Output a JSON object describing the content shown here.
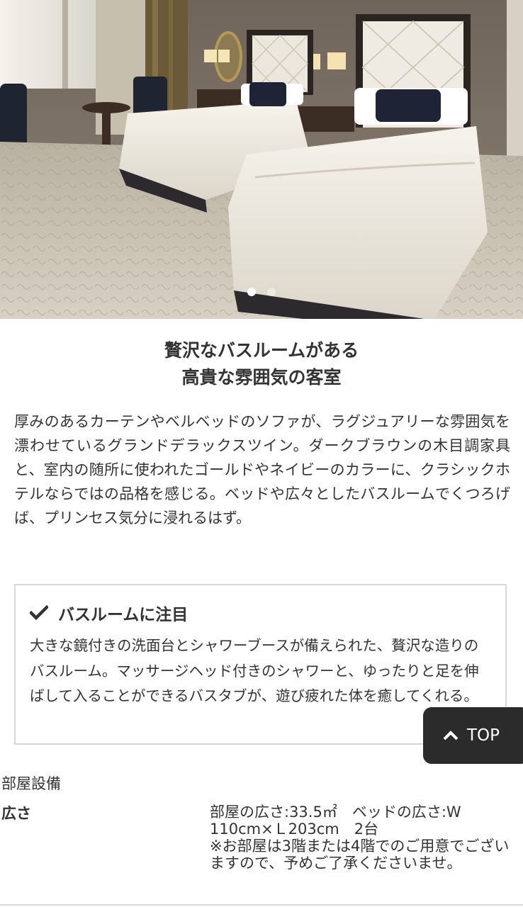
{
  "hero": {
    "image_alt": "",
    "carousel": {
      "total": 2,
      "active": 1
    }
  },
  "heading": {
    "line1": "贅沢なバスルームがある",
    "line2": "高貴な雰囲気の客室"
  },
  "description": "厚みのあるカーテンやベルベッドのソファが、ラグジュアリーな雰囲気を漂わせているグランドデラックスツイン。ダークブラウンの木目調家具と、室内の随所に使われたゴールドやネイビーのカラーに、クラシックホテルならではの品格を感じる。ベッドや広々としたバスルームでくつろげば、プリンセス気分に浸れるはず。",
  "feature_box": {
    "icon": "check-icon",
    "title": "バスルームに注目",
    "text": "大きな鏡付きの洗面台とシャワーブースが備えられた、贅沢な造りのバスルーム。マッサージヘッド付きのシャワーと、ゆったりと足を伸ばして入ることができるバスタブが、遊び疲れた体を癒してくれる。"
  },
  "top_button": {
    "icon": "chevron-up-icon",
    "label": "TOP"
  },
  "facilities": {
    "heading": "部屋設備",
    "rows": [
      {
        "label": "広さ",
        "value_line1": "部屋の広さ:33.5㎡　ベッドの広さ:W 110cm×Ｌ203cm　2台",
        "value_line2": "※お部屋は3階または4階でのご用意でございますので、予めご了承くださいませ。"
      }
    ]
  },
  "colors": {
    "text": "#333333",
    "box_border": "#d9d9d9",
    "top_button_bg": "#2b2b2b"
  }
}
